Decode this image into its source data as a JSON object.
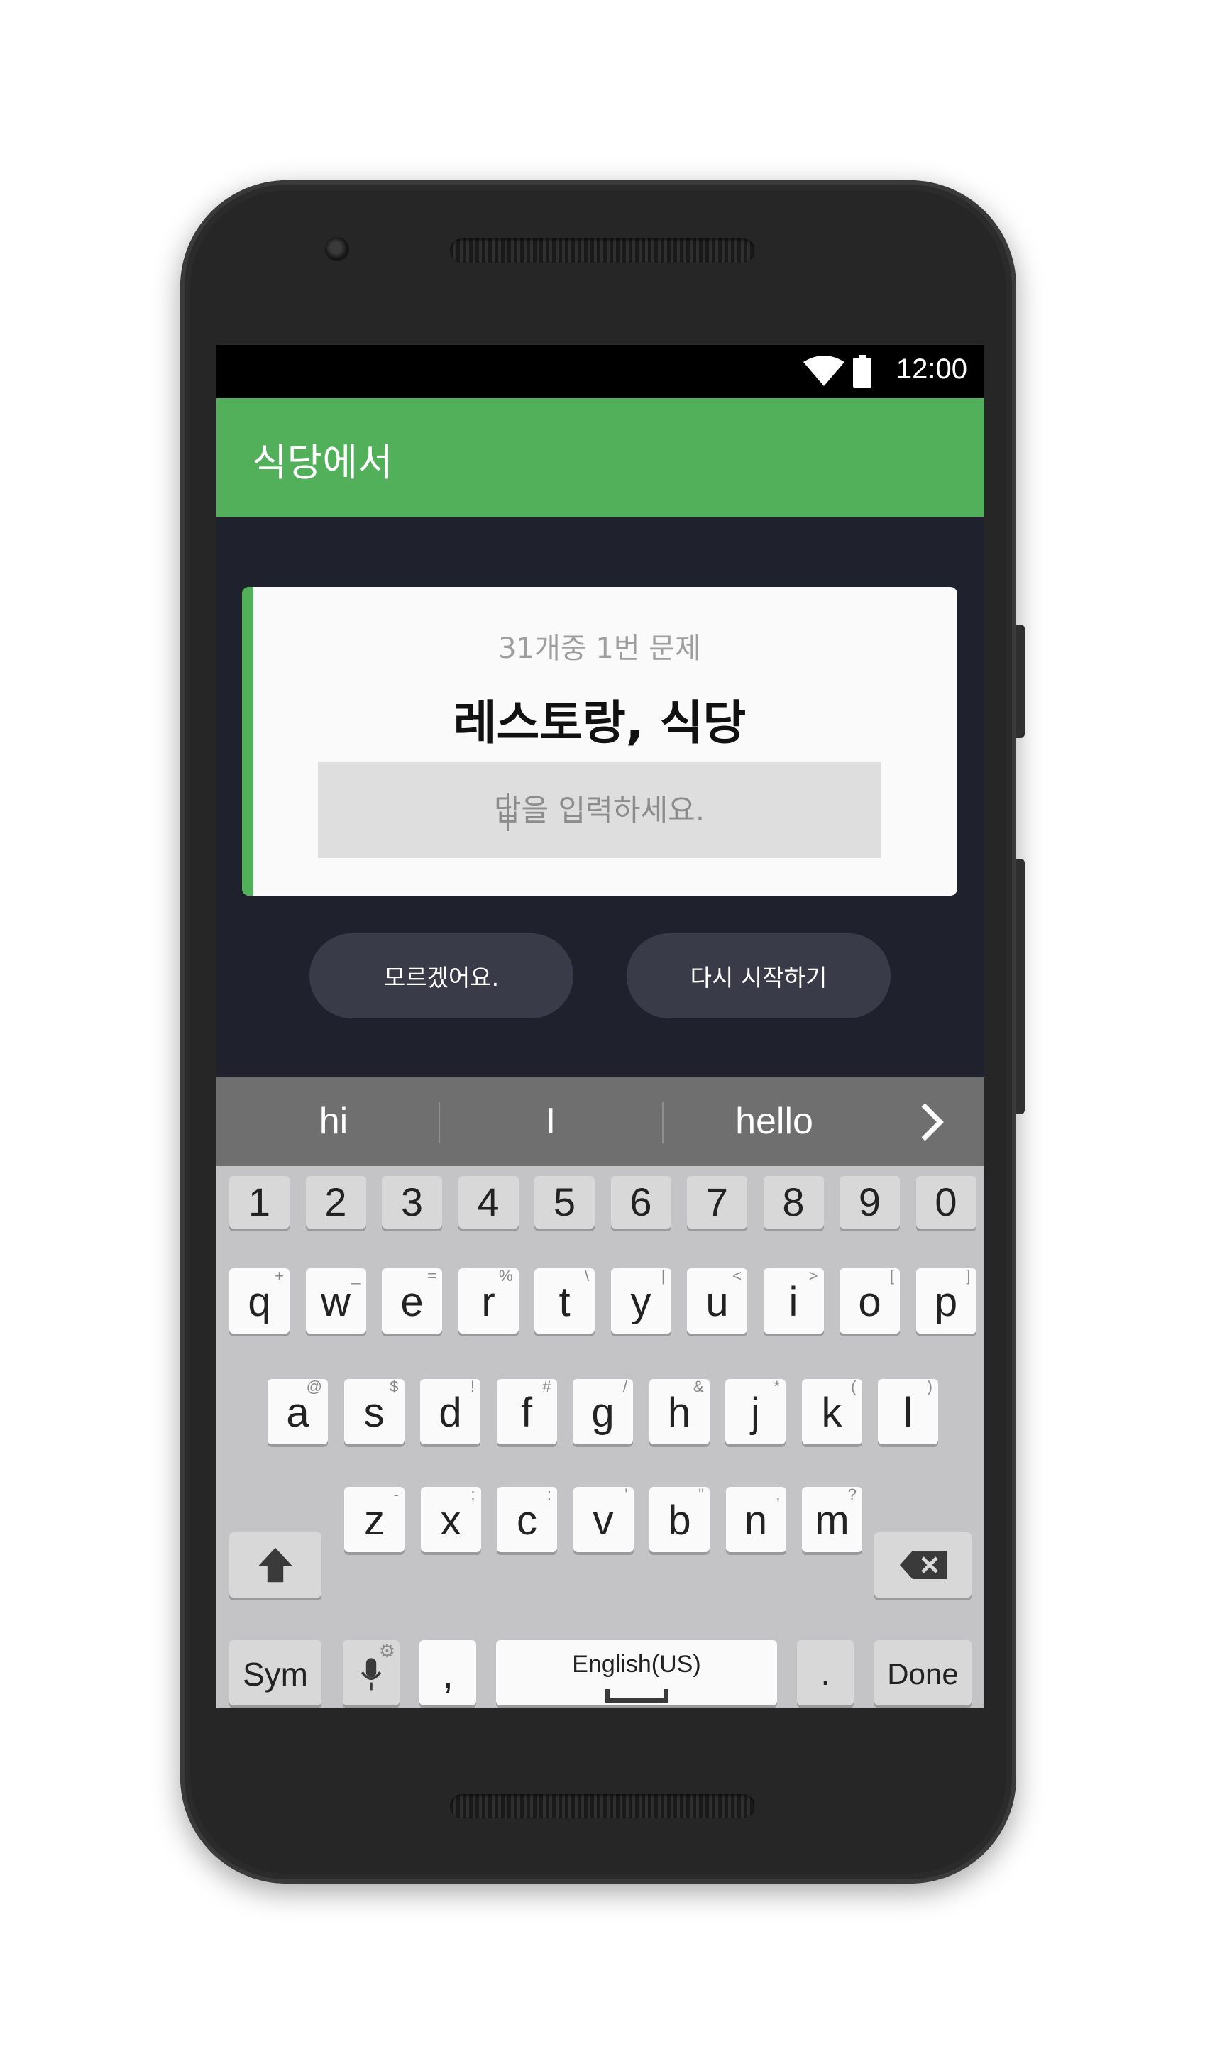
{
  "status": {
    "time": "12:00"
  },
  "app": {
    "title": "식당에서"
  },
  "card": {
    "progress": "31개중 1번 문제",
    "word": "레스토랑, 식당",
    "answer_placeholder": "답을 입력하세요."
  },
  "buttons": {
    "dont_know": "모르겠어요.",
    "restart": "다시 시작하기"
  },
  "suggestions": [
    "hi",
    "I",
    "hello"
  ],
  "keyboard": {
    "numbers": [
      "1",
      "2",
      "3",
      "4",
      "5",
      "6",
      "7",
      "8",
      "9",
      "0"
    ],
    "row1": [
      {
        "k": "q",
        "h": "+"
      },
      {
        "k": "w",
        "h": "_"
      },
      {
        "k": "e",
        "h": "="
      },
      {
        "k": "r",
        "h": "%"
      },
      {
        "k": "t",
        "h": "\\"
      },
      {
        "k": "y",
        "h": "|"
      },
      {
        "k": "u",
        "h": "<"
      },
      {
        "k": "i",
        "h": ">"
      },
      {
        "k": "o",
        "h": "["
      },
      {
        "k": "p",
        "h": "]"
      }
    ],
    "row2": [
      {
        "k": "a",
        "h": "@"
      },
      {
        "k": "s",
        "h": "$"
      },
      {
        "k": "d",
        "h": "!"
      },
      {
        "k": "f",
        "h": "#"
      },
      {
        "k": "g",
        "h": "/"
      },
      {
        "k": "h",
        "h": "&"
      },
      {
        "k": "j",
        "h": "*"
      },
      {
        "k": "k",
        "h": "("
      },
      {
        "k": "l",
        "h": ")"
      }
    ],
    "row3": [
      {
        "k": "z",
        "h": "-"
      },
      {
        "k": "x",
        "h": ";"
      },
      {
        "k": "c",
        "h": ":"
      },
      {
        "k": "v",
        "h": "'"
      },
      {
        "k": "b",
        "h": "\""
      },
      {
        "k": "n",
        "h": ","
      },
      {
        "k": "m",
        "h": "?"
      }
    ],
    "sym": "Sym",
    "comma": ",",
    "space": "English(US)",
    "period": ".",
    "done": "Done"
  },
  "colors": {
    "accent": "#52b05b",
    "background": "#1f222d",
    "card": "#fafafa",
    "pill": "#393c48"
  }
}
